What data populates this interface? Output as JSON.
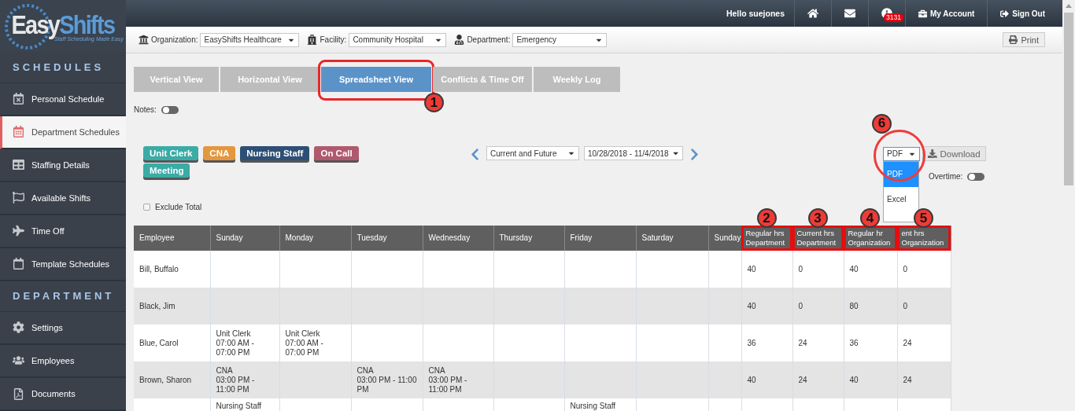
{
  "logo": {
    "brand_first": "Easy",
    "brand_second": "Shifts",
    "tagline": "Staff Scheduling Made Easy"
  },
  "sidebar": {
    "sections": [
      {
        "title": "SCHEDULES",
        "items": [
          {
            "label": "Personal Schedule",
            "selected": false
          },
          {
            "label": "Department Schedules",
            "selected": true
          },
          {
            "label": "Staffing Details",
            "selected": false
          },
          {
            "label": "Available Shifts",
            "selected": false
          },
          {
            "label": "Time Off",
            "selected": false
          },
          {
            "label": "Template Schedules",
            "selected": false
          }
        ]
      },
      {
        "title": "DEPARTMENT",
        "items": [
          {
            "label": "Settings",
            "selected": false
          },
          {
            "label": "Employees",
            "selected": false
          },
          {
            "label": "Documents",
            "selected": false
          }
        ]
      }
    ]
  },
  "top_bar": {
    "greeting": "Hello suejones",
    "nav": [
      {
        "kind": "home"
      },
      {
        "kind": "mail"
      },
      {
        "kind": "info",
        "badge": "3131"
      },
      {
        "kind": "account",
        "label": "My Account"
      },
      {
        "kind": "signout",
        "label": "Sign Out"
      }
    ]
  },
  "filters": [
    {
      "label": "Organization:",
      "value": "EasyShifts Healthcare"
    },
    {
      "label": "Facility:",
      "value": "Community Hospital"
    },
    {
      "label": "Department:",
      "value": "Emergency"
    }
  ],
  "print_button": "Print",
  "tabs": [
    {
      "label": "Vertical View",
      "selected": false
    },
    {
      "label": "Horizontal View",
      "selected": false
    },
    {
      "label": "Spreadsheet View",
      "selected": true,
      "callout": "1"
    },
    {
      "label": "Conflicts & Time Off",
      "selected": false
    },
    {
      "label": "Weekly Log",
      "selected": false
    }
  ],
  "notes": {
    "label": "Notes:",
    "on": false
  },
  "tags": [
    {
      "label": "Unit Clerk",
      "color": "#3aaba5"
    },
    {
      "label": "CNA",
      "color": "#e3973e"
    },
    {
      "label": "Nursing Staff",
      "color": "#2e4f75"
    },
    {
      "label": "On Call",
      "color": "#b0596e"
    },
    {
      "label": "Meeting",
      "color": "#3aaba5"
    }
  ],
  "range": {
    "mode": "Current and Future",
    "dates": "10/28/2018 - 11/4/2018"
  },
  "export": {
    "format": "PDF",
    "button": "Download",
    "callout": "6",
    "expanded": true,
    "options": [
      {
        "label": "PDF",
        "selected": true
      },
      {
        "label": "Excel",
        "selected": false
      }
    ]
  },
  "overtime": {
    "label": "Overtime:",
    "on": false
  },
  "exclude_total": {
    "label": "Exclude Total",
    "checked": false
  },
  "table": {
    "columns": [
      {
        "label": "Employee"
      },
      {
        "label": "Sunday"
      },
      {
        "label": "Monday"
      },
      {
        "label": "Tuesday"
      },
      {
        "label": "Wednesday"
      },
      {
        "label": "Thursday"
      },
      {
        "label": "Friday"
      },
      {
        "label": "Saturday"
      },
      {
        "label": "Sunday"
      },
      {
        "label": "Regular hrs Department",
        "callout": "2"
      },
      {
        "label": "Current hrs Department",
        "callout": "3"
      },
      {
        "label": "Regular hr Organization",
        "callout": "4"
      },
      {
        "label": "ent hrs Organization",
        "callout": "5"
      }
    ],
    "rows": [
      {
        "employee": "Bill, Buffalo",
        "hours": [
          "40",
          "0",
          "40",
          "0"
        ]
      },
      {
        "employee": "Black, Jim",
        "hours": [
          "40",
          "0",
          "80",
          "0"
        ]
      },
      {
        "employee": "Blue, Carol",
        "sunday": {
          "role": "Unit Clerk",
          "time": "07:00 AM - 07:00 PM"
        },
        "monday": {
          "role": "Unit Clerk",
          "time": "07:00 AM - 07:00 PM"
        },
        "hours": [
          "36",
          "24",
          "36",
          "24"
        ]
      },
      {
        "employee": "Brown, Sharon",
        "sunday": {
          "role": "CNA",
          "time": "03:00 PM - 11:00 PM"
        },
        "tuesday": {
          "role": "CNA",
          "time": "03:00 PM - 11:00 PM"
        },
        "wednesday": {
          "role": "CNA",
          "time": "03:00 PM - 11:00 PM"
        },
        "hours": [
          "40",
          "24",
          "40",
          "24"
        ]
      },
      {
        "sunday": {
          "role": "Nursing Staff"
        },
        "friday": {
          "role": "Nursing Staff"
        }
      }
    ]
  }
}
